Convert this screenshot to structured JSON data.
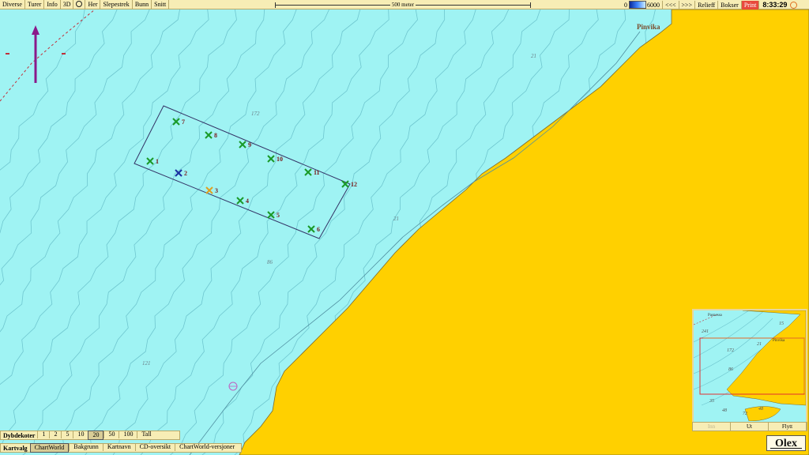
{
  "toolbar": {
    "items": [
      "Diverse",
      "Turer",
      "Info",
      "3D",
      "Her",
      "Slepestrek",
      "Bunn",
      "Snitt"
    ],
    "scale_label": "500 meter",
    "depth_min": "0",
    "depth_max": "6000",
    "prev": "<<<",
    "next": ">>>",
    "relieff": "Relieff",
    "bokser": "Bokser",
    "print": "Print",
    "time": "8:33:29"
  },
  "map": {
    "place_name": "Pinvika",
    "depth_labels": [
      "172",
      "21",
      "21",
      "86",
      "121"
    ],
    "waypoints": [
      {
        "n": "1",
        "color": "green"
      },
      {
        "n": "2",
        "color": "blue"
      },
      {
        "n": "3",
        "color": "orange"
      },
      {
        "n": "4",
        "color": "green"
      },
      {
        "n": "5",
        "color": "green"
      },
      {
        "n": "6",
        "color": "green"
      },
      {
        "n": "7",
        "color": "green"
      },
      {
        "n": "8",
        "color": "green"
      },
      {
        "n": "9",
        "color": "green"
      },
      {
        "n": "10",
        "color": "green"
      },
      {
        "n": "11",
        "color": "green"
      },
      {
        "n": "12",
        "color": "green"
      }
    ],
    "colors": {
      "water": "#9ff3f3",
      "land": "#ffd000",
      "marker_green": "#1a9a28",
      "marker_blue": "#1a30a0",
      "marker_orange": "#e0a020",
      "route": "#333366"
    }
  },
  "dybdekoter": {
    "label": "Dybdekoter",
    "options": [
      "1",
      "2",
      "5",
      "10",
      "20",
      "50",
      "100",
      "Tall"
    ],
    "selected": "20"
  },
  "kartvalg": {
    "label": "Kartvalg",
    "options": [
      "ChartWorld",
      "Bakgrunn",
      "Kartnavn",
      "CD-oversikt",
      "ChartWorld-versjoner"
    ],
    "selected": "ChartWorld"
  },
  "inset": {
    "labels": [
      "Pasnessa",
      "241",
      "15",
      "Pinvika",
      "172",
      "21",
      "86",
      "35",
      "48",
      "72",
      "48"
    ],
    "buttons": [
      "Inn",
      "Ut",
      "Flytt"
    ]
  },
  "logo": "Olex"
}
